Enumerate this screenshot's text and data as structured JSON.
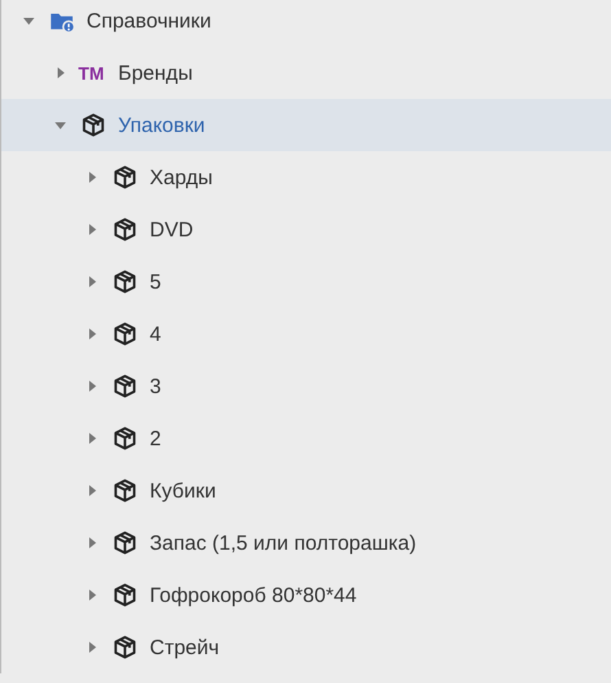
{
  "tree": [
    {
      "label": "Справочники",
      "kind": "folder",
      "expanded": true,
      "selected": false,
      "children": [
        {
          "label": "Бренды",
          "kind": "mark",
          "mark": "TM",
          "expanded": false,
          "selected": false
        },
        {
          "label": "Упаковки",
          "kind": "box",
          "expanded": true,
          "selected": true,
          "children": [
            {
              "label": "Харды",
              "kind": "box",
              "expanded": false,
              "selected": false
            },
            {
              "label": "DVD",
              "kind": "box",
              "expanded": false,
              "selected": false
            },
            {
              "label": "5",
              "kind": "box",
              "expanded": false,
              "selected": false
            },
            {
              "label": "4",
              "kind": "box",
              "expanded": false,
              "selected": false
            },
            {
              "label": "3",
              "kind": "box",
              "expanded": false,
              "selected": false
            },
            {
              "label": "2",
              "kind": "box",
              "expanded": false,
              "selected": false
            },
            {
              "label": "Кубики",
              "kind": "box",
              "expanded": false,
              "selected": false
            },
            {
              "label": "Запас (1,5 или полторашка)",
              "kind": "box",
              "expanded": false,
              "selected": false
            },
            {
              "label": "Гофрокороб 80*80*44",
              "kind": "box",
              "expanded": false,
              "selected": false
            },
            {
              "label": "Стрейч",
              "kind": "box",
              "expanded": false,
              "selected": false
            }
          ]
        }
      ]
    }
  ]
}
